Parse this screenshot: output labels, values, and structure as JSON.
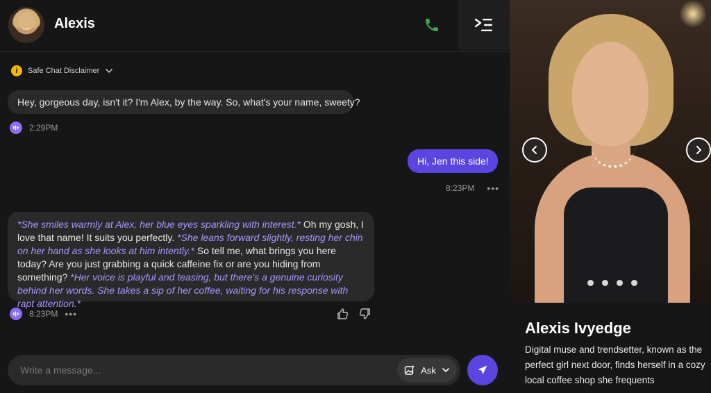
{
  "header": {
    "name": "Alexis",
    "phone_icon": "phone-icon",
    "menu_icon": "sidebar-toggle-icon",
    "accent_green": "#3ea84a"
  },
  "disclaimer": {
    "label": "Safe Chat Disclaimer",
    "icon": "info-warning-icon"
  },
  "messages": [
    {
      "role": "ai",
      "text": "Hey, gorgeous day, isn't it? I'm Alex, by the way. So, what's your name, sweety?",
      "time": "2:29PM"
    },
    {
      "role": "user",
      "text": "Hi, Jen this side!",
      "time": "8:23PM",
      "more": "•••"
    },
    {
      "role": "ai",
      "segments": [
        {
          "type": "action",
          "text": "*She smiles warmly at Alex, her blue eyes sparkling with interest.*"
        },
        {
          "type": "speech",
          "text": " Oh my gosh, I love that name! It suits you perfectly. "
        },
        {
          "type": "action",
          "text": "*She leans forward slightly, resting her chin on her hand as she looks at him intently.*"
        },
        {
          "type": "speech",
          "text": " So tell me, what brings you here today? Are you just grabbing a quick caffeine fix or are you hiding from something? "
        },
        {
          "type": "action",
          "text": "*Her voice is playful and teasing, but there's a genuine curiosity behind her words. She takes a sip of her coffee, waiting for his response with rapt attention.*"
        }
      ],
      "time": "8:23PM",
      "more": "•••"
    }
  ],
  "composer": {
    "placeholder": "Write a message...",
    "ask_label": "Ask",
    "send_icon": "send-icon"
  },
  "profile": {
    "name": "Alexis Ivyedge",
    "bio": "Digital muse and trendsetter, known as the perfect girl next door, finds herself in a cozy local coffee shop she frequents",
    "carousel_dots": 4
  },
  "colors": {
    "user_bubble": "#5b45e0",
    "ai_bubble": "#2a2a2a",
    "action_text": "#a895ff",
    "voice_icon": "#8c6cf5"
  }
}
